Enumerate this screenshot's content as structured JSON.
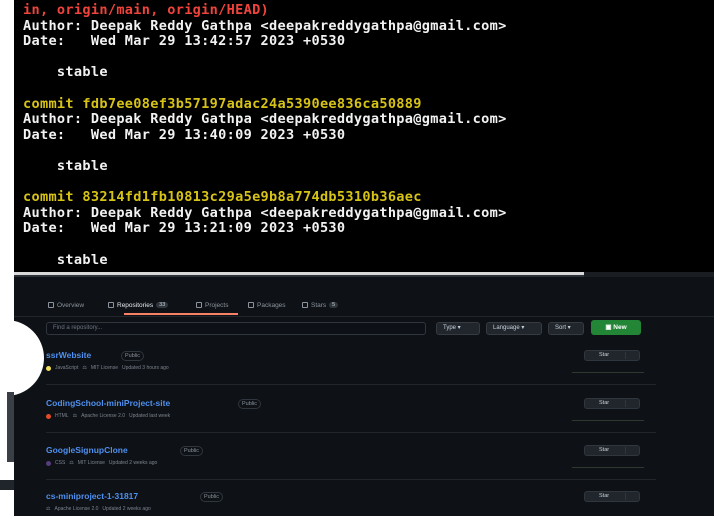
{
  "terminal": {
    "lines": [
      {
        "text": "in, origin/main, origin/HEAD)",
        "color": "red"
      },
      {
        "text": "Author: Deepak Reddy Gathpa <deepakreddygathpa@gmail.com>",
        "color": "white"
      },
      {
        "text": "Date:   Wed Mar 29 13:42:57 2023 +0530",
        "color": "white"
      },
      {
        "text": "",
        "color": "white"
      },
      {
        "text": "    stable",
        "color": "white"
      },
      {
        "text": "",
        "color": "white"
      },
      {
        "text": "commit fdb7ee08ef3b57197adac24a5390ee836ca50889",
        "color": "yellow"
      },
      {
        "text": "Author: Deepak Reddy Gathpa <deepakreddygathpa@gmail.com>",
        "color": "white"
      },
      {
        "text": "Date:   Wed Mar 29 13:40:09 2023 +0530",
        "color": "white"
      },
      {
        "text": "",
        "color": "white"
      },
      {
        "text": "    stable",
        "color": "white"
      },
      {
        "text": "",
        "color": "white"
      },
      {
        "text": "commit 83214fd1fb10813c29a5e9b8a774db5310b36aec",
        "color": "yellow"
      },
      {
        "text": "Author: Deepak Reddy Gathpa <deepakreddygathpa@gmail.com>",
        "color": "white"
      },
      {
        "text": "Date:   Wed Mar 29 13:21:09 2023 +0530",
        "color": "white"
      },
      {
        "text": "",
        "color": "white"
      },
      {
        "text": "    stable",
        "color": "white"
      }
    ]
  },
  "github": {
    "tabs": [
      {
        "label": "Overview",
        "icon": "book-icon",
        "active": false
      },
      {
        "label": "Repositories",
        "icon": "repo-icon",
        "active": true,
        "count": "33"
      },
      {
        "label": "Projects",
        "icon": "project-icon",
        "active": false
      },
      {
        "label": "Packages",
        "icon": "package-icon",
        "active": false
      },
      {
        "label": "Stars",
        "icon": "star-icon",
        "active": false,
        "count": "5"
      }
    ],
    "find_placeholder": "Find a repository...",
    "filters": {
      "type": "Type ▾",
      "language": "Language ▾",
      "sort": "Sort ▾"
    },
    "new_button": "New",
    "repos": [
      {
        "name": "ssrWebsite",
        "visibility": "Public",
        "language": "JavaScript",
        "lang_color": "#f1e05a",
        "license": "MIT License",
        "updated": "Updated 3 hours ago",
        "star_label": "Star"
      },
      {
        "name": "CodingSchool-miniProject-site",
        "visibility": "Public",
        "language": "HTML",
        "lang_color": "#e34c26",
        "license": "Apache License 2.0",
        "updated": "Updated last week",
        "star_label": "Star"
      },
      {
        "name": "GoogleSignupClone",
        "visibility": "Public",
        "language": "CSS",
        "lang_color": "#563d7c",
        "license": "MIT License",
        "updated": "Updated 2 weeks ago",
        "star_label": "Star"
      },
      {
        "name": "cs-miniproject-1-31817",
        "visibility": "Public",
        "language": "",
        "lang_color": "",
        "license": "Apache License 2.0",
        "updated": "Updated 2 weeks ago",
        "star_label": "Star"
      }
    ]
  }
}
